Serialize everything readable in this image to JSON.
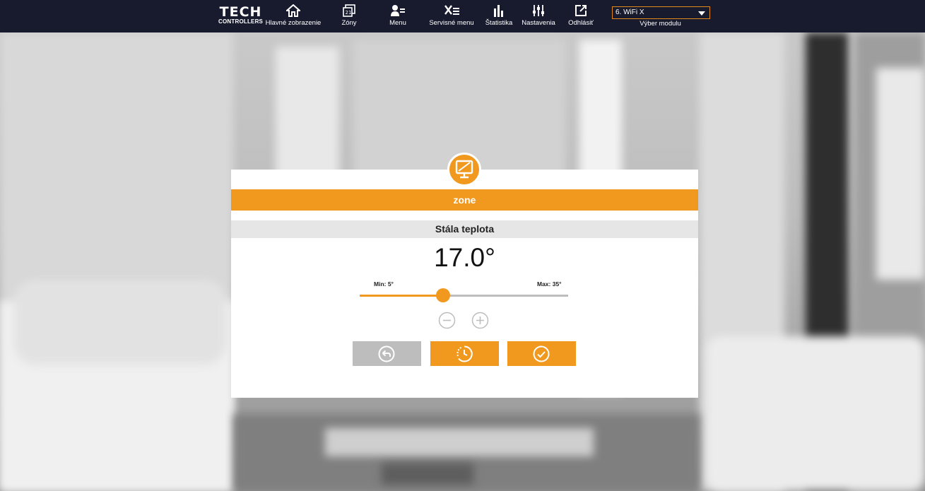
{
  "brand": {
    "name": "TECH",
    "tagline": "CONTROLLERS"
  },
  "nav": {
    "items": [
      {
        "label": "Hlavné zobrazenie",
        "icon": "home-icon"
      },
      {
        "label": "Zóny",
        "icon": "zones-icon"
      },
      {
        "label": "Menu",
        "icon": "user-menu-icon"
      },
      {
        "label": "Servisné menu",
        "icon": "service-tools-icon"
      },
      {
        "label": "Štatistika",
        "icon": "statistics-icon"
      },
      {
        "label": "Nastavenia",
        "icon": "settings-sliders-icon"
      },
      {
        "label": "Odhlásiť",
        "icon": "logout-icon"
      }
    ],
    "module_select": {
      "value": "6. WiFi X",
      "label": "Výber modulu"
    }
  },
  "dialog": {
    "icon": "monitor-icon",
    "zone_name": "zone",
    "mode": "Stála teplota",
    "temperature": "17.0°",
    "slider": {
      "min_label": "Min: 5°",
      "max_label": "Max: 35°",
      "min": 5,
      "max": 35,
      "value": 17
    },
    "buttons": {
      "minus": "minus-circle-icon",
      "plus": "plus-circle-icon",
      "back": "back-arrow-icon",
      "schedule": "clock-schedule-icon",
      "confirm": "check-circle-icon"
    }
  },
  "colors": {
    "accent": "#f0991e",
    "topbar": "#181b2e",
    "back_button": "#bdbdbd",
    "mode_bar": "#e6e6e6",
    "disabled_icon": "#bdbdbd"
  }
}
